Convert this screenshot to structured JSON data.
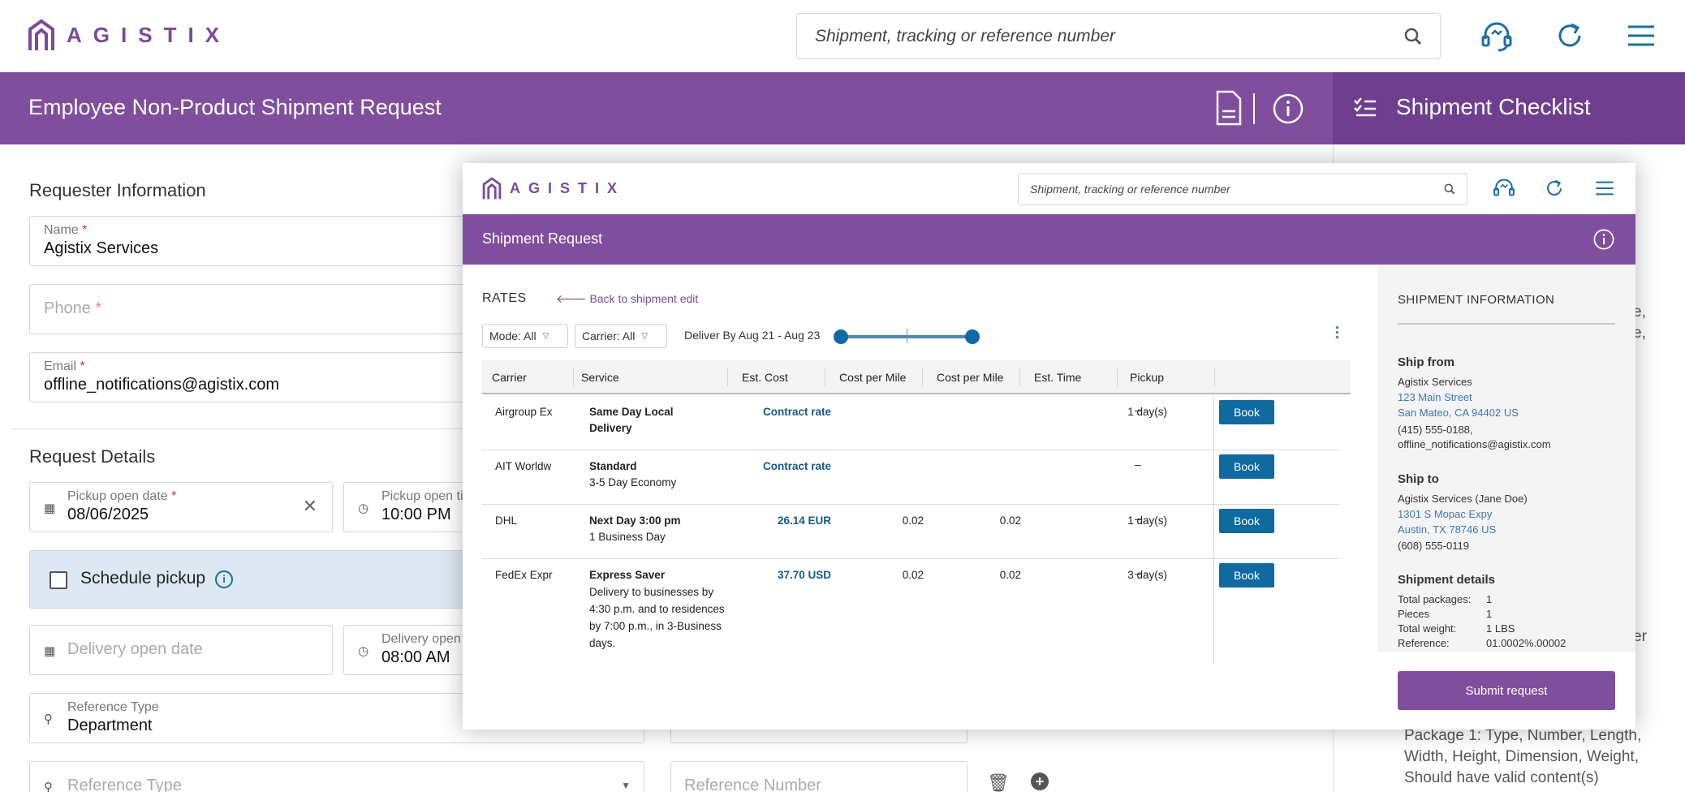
{
  "brand": {
    "name": "AGISTIX",
    "color": "#7a4a9c"
  },
  "header": {
    "search_placeholder": "Shipment, tracking or reference number",
    "icons": [
      "headset-icon",
      "refresh-icon",
      "hamburger-menu-icon"
    ]
  },
  "page": {
    "title": "Employee Non-Product Shipment Request",
    "checklist_title": "Shipment Checklist",
    "requester": {
      "heading": "Requester Information",
      "name_label": "Name",
      "name_value": "Agistix Services",
      "phone_label": "Phone",
      "email_label": "Email",
      "email_value": "offline_notifications@agistix.com"
    },
    "request_details": {
      "heading": "Request Details",
      "pickup_date_label": "Pickup open date",
      "pickup_date_value": "08/06/2025",
      "pickup_time_label": "Pickup open ti",
      "pickup_time_value": "10:00 PM",
      "schedule_pickup_label": "Schedule pickup",
      "delivery_date_placeholder": "Delivery open date",
      "delivery_time_label": "Delivery open",
      "delivery_time_value": "08:00 AM",
      "reference_type_label": "Reference Type",
      "reference_type_value": "Department",
      "reference_type_placeholder": "Reference Type",
      "reference_number_placeholder": "Reference Number"
    },
    "checklist_fragments": [
      "e,",
      "e,",
      "er"
    ],
    "package_note": [
      "Package 1:  Type, Number, Length,",
      "Width, Height, Dimension, Weight,",
      "Should have valid content(s)"
    ]
  },
  "modal": {
    "search_placeholder": "Shipment, tracking or reference number",
    "title": "Shipment Request",
    "rates_heading": "RATES",
    "back_link": "Back to shipment edit",
    "filters": {
      "mode": "Mode: All",
      "carrier": "Carrier: All"
    },
    "deliver_by": "Deliver By Aug 21 - Aug 23",
    "columns": [
      "Carrier",
      "Service",
      "Est. Cost",
      "Cost per Mile",
      "Cost per Mile",
      "Est. Time",
      "Pickup"
    ],
    "rows": [
      {
        "carrier": "Airgroup Ex",
        "service_name": "Same Day Local Delivery",
        "service_desc": "",
        "cost": "Contract rate",
        "cpm1": "",
        "cpm2": "",
        "time": "1 day(s)",
        "pickup": "–",
        "action": "Book"
      },
      {
        "carrier": "AIT Worldw",
        "service_name": "Standard",
        "service_desc": "3-5 Day Economy",
        "cost": "Contract rate",
        "cpm1": "",
        "cpm2": "",
        "time": "",
        "pickup": "–",
        "action": "Book"
      },
      {
        "carrier": "DHL",
        "service_name": "Next Day 3:00 pm",
        "service_desc": "1 Business Day",
        "cost": "26.14 EUR",
        "cpm1": "0.02",
        "cpm2": "0.02",
        "time": "1 day(s)",
        "pickup": "–",
        "action": "Book"
      },
      {
        "carrier": "FedEx Expr",
        "service_name": "Express Saver",
        "service_desc": "Delivery to businesses by 4:30 p.m. and to residences by 7:00 p.m., in 3-Business days.",
        "cost": "37.70 USD",
        "cpm1": "0.02",
        "cpm2": "0.02",
        "time": "3 day(s)",
        "pickup": "–",
        "action": "Book"
      }
    ],
    "info": {
      "heading": "SHIPMENT INFORMATION",
      "ship_from": {
        "label": "Ship from",
        "name": "Agistix Services",
        "address1": "123 Main Street",
        "address2": "San Mateo, CA 94402 US",
        "phone": "(415) 555-0188,",
        "email": "offline_notifications@agistix.com"
      },
      "ship_to": {
        "label": "Ship to",
        "name": "Agistix Services (Jane Doe)",
        "address1": "1301 S Mopac Expy",
        "address2": "Austin, TX 78746 US",
        "phone": "(608) 555-0119"
      },
      "details": {
        "label": "Shipment details",
        "items": [
          {
            "k": "Total packages:",
            "v": "1"
          },
          {
            "k": "Pieces",
            "v": "1"
          },
          {
            "k": "Total weight:",
            "v": "1 LBS"
          },
          {
            "k": "Reference:",
            "v": "01.0002%.00002"
          }
        ]
      }
    },
    "submit_label": "Submit request"
  }
}
